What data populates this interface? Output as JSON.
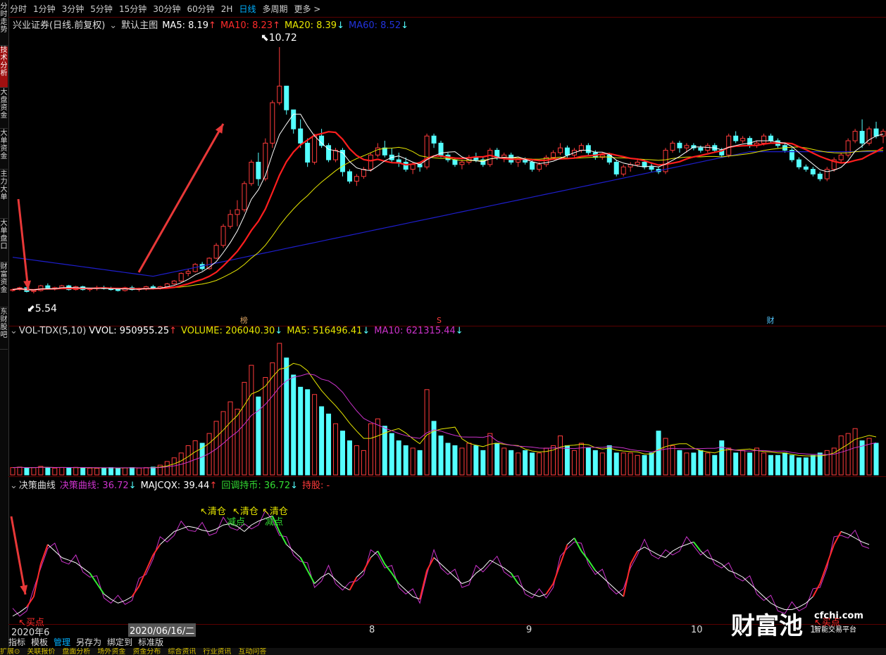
{
  "sidebar": {
    "tabs": [
      "分时走势",
      "技术分析",
      "大盘资金",
      "大单资金",
      "主力大单",
      "大单盘口",
      "财富资金",
      "东财股吧"
    ],
    "active_index": 1
  },
  "period_bar": {
    "items": [
      "分时",
      "1分钟",
      "3分钟",
      "5分钟",
      "15分钟",
      "30分钟",
      "60分钟",
      "2H",
      "日线",
      "多周期",
      "更多"
    ],
    "active": "日线"
  },
  "main_legend": {
    "name": "兴业证券(日线.前复权)",
    "template": "默认主图",
    "ma5": "MA5: 8.19",
    "ma5_arrow": "↑",
    "ma10": "MA10: 8.23",
    "ma10_arrow": "↑",
    "ma20": "MA20: 8.39",
    "ma20_arrow": "↓",
    "ma60": "MA60: 8.52",
    "ma60_arrow": "↓"
  },
  "price_labels": {
    "high": "10.72",
    "low": "5.54"
  },
  "event_markers": [
    "榜",
    "S",
    "财"
  ],
  "volume_legend": {
    "name": "VOL-TDX(5,10)",
    "vvol": "VVOL: 950955.25",
    "vvol_arrow": "↑",
    "volume": "VOLUME: 206040.30",
    "volume_arrow": "↓",
    "ma5": "MA5: 516496.41",
    "ma5_arrow": "↓",
    "ma10": "MA10: 621315.44",
    "ma10_arrow": "↓"
  },
  "decision_legend": {
    "name": "决策曲线",
    "curve": "决策曲线: 36.72",
    "curve_arrow": "↓",
    "majcqx": "MAJCQX: 39.44",
    "majcqx_arrow": "↑",
    "hold": "回调持币: 36.72",
    "hold_arrow": "↓",
    "position": "持股: -"
  },
  "signals": {
    "clear1": "清仓",
    "clear2": "清仓",
    "clear3": "清仓",
    "reduce1": "减点",
    "reduce2": "减点",
    "buy": "买点",
    "buy2": "买点"
  },
  "date_axis": {
    "labels": [
      "2020年6",
      "8",
      "9",
      "10",
      "1"
    ],
    "cursor_date": "2020/06/16/二"
  },
  "bottom_bar": {
    "items": [
      "指标",
      "模板",
      "管理",
      "另存为",
      "绑定到",
      "标准版"
    ],
    "active": "管理"
  },
  "status_bar": {
    "items": [
      "扩展⊙",
      "关联报价",
      "盘面分析",
      "场外资金",
      "资金分布",
      "综合资讯",
      "行业资讯",
      "互动问答"
    ]
  },
  "watermark": {
    "text": "财富池",
    "site": "cfchi.com",
    "sub": "智能交易平台"
  },
  "colors": {
    "up": "#ff3b3b",
    "down": "#54ffff",
    "ma5": "#ffffff",
    "ma10": "#ff1e1e",
    "ma20": "#e6e600",
    "ma60": "#1e1ecc",
    "vol_ma5": "#e6e600",
    "vol_ma10": "#cc33cc",
    "arrow": "#e83838"
  },
  "chart_data": {
    "type": "candlestick",
    "date_range": [
      "2020-06",
      "2020-10"
    ],
    "ylim": [
      5.2,
      11.0
    ],
    "ohlc": [
      [
        5.6,
        5.64,
        5.58,
        5.62
      ],
      [
        5.62,
        5.68,
        5.6,
        5.66
      ],
      [
        5.66,
        5.66,
        5.56,
        5.58
      ],
      [
        5.58,
        5.62,
        5.54,
        5.6
      ],
      [
        5.6,
        5.72,
        5.58,
        5.7
      ],
      [
        5.7,
        5.75,
        5.62,
        5.64
      ],
      [
        5.64,
        5.68,
        5.6,
        5.66
      ],
      [
        5.66,
        5.72,
        5.63,
        5.7
      ],
      [
        5.7,
        5.72,
        5.6,
        5.62
      ],
      [
        5.62,
        5.7,
        5.6,
        5.68
      ],
      [
        5.68,
        5.7,
        5.6,
        5.62
      ],
      [
        5.62,
        5.66,
        5.58,
        5.64
      ],
      [
        5.64,
        5.7,
        5.6,
        5.66
      ],
      [
        5.66,
        5.7,
        5.62,
        5.64
      ],
      [
        5.64,
        5.68,
        5.6,
        5.62
      ],
      [
        5.62,
        5.66,
        5.58,
        5.6
      ],
      [
        5.6,
        5.68,
        5.58,
        5.66
      ],
      [
        5.66,
        5.7,
        5.6,
        5.62
      ],
      [
        5.62,
        5.66,
        5.58,
        5.64
      ],
      [
        5.64,
        5.7,
        5.6,
        5.68
      ],
      [
        5.68,
        5.72,
        5.62,
        5.64
      ],
      [
        5.64,
        5.7,
        5.62,
        5.68
      ],
      [
        5.68,
        5.76,
        5.66,
        5.74
      ],
      [
        5.74,
        5.82,
        5.72,
        5.8
      ],
      [
        5.8,
        5.98,
        5.78,
        5.96
      ],
      [
        5.96,
        6.05,
        5.9,
        6.0
      ],
      [
        6.0,
        6.18,
        5.98,
        6.15
      ],
      [
        6.15,
        6.2,
        6.02,
        6.06
      ],
      [
        6.06,
        6.3,
        6.04,
        6.28
      ],
      [
        6.28,
        6.6,
        6.26,
        6.55
      ],
      [
        6.55,
        7.0,
        6.5,
        6.95
      ],
      [
        6.95,
        7.3,
        6.9,
        7.2
      ],
      [
        7.2,
        7.5,
        6.95,
        7.3
      ],
      [
        7.3,
        7.9,
        7.25,
        7.85
      ],
      [
        7.85,
        8.35,
        7.8,
        8.3
      ],
      [
        8.3,
        8.5,
        7.8,
        7.95
      ],
      [
        7.95,
        8.8,
        7.9,
        8.7
      ],
      [
        8.7,
        9.6,
        8.6,
        9.55
      ],
      [
        9.55,
        10.72,
        9.5,
        9.9
      ],
      [
        9.9,
        9.9,
        9.3,
        9.4
      ],
      [
        9.4,
        9.4,
        8.9,
        9.0
      ],
      [
        9.0,
        9.2,
        8.6,
        8.7
      ],
      [
        8.7,
        8.8,
        8.2,
        8.3
      ],
      [
        8.3,
        8.9,
        8.25,
        8.85
      ],
      [
        8.85,
        9.0,
        8.6,
        8.65
      ],
      [
        8.65,
        8.7,
        8.3,
        8.35
      ],
      [
        8.35,
        8.6,
        8.3,
        8.55
      ],
      [
        8.55,
        8.6,
        8.0,
        8.1
      ],
      [
        8.1,
        8.15,
        7.85,
        7.9
      ],
      [
        7.9,
        8.05,
        7.8,
        8.0
      ],
      [
        8.0,
        8.2,
        7.95,
        8.15
      ],
      [
        8.15,
        8.5,
        8.1,
        8.45
      ],
      [
        8.45,
        8.7,
        8.4,
        8.6
      ],
      [
        8.6,
        8.75,
        8.4,
        8.45
      ],
      [
        8.45,
        8.6,
        8.3,
        8.35
      ],
      [
        8.35,
        8.5,
        8.2,
        8.3
      ],
      [
        8.3,
        8.4,
        8.1,
        8.15
      ],
      [
        8.15,
        8.3,
        8.05,
        8.25
      ],
      [
        8.25,
        8.3,
        8.1,
        8.2
      ],
      [
        8.2,
        8.9,
        8.15,
        8.85
      ],
      [
        8.85,
        8.9,
        8.6,
        8.7
      ],
      [
        8.7,
        8.75,
        8.4,
        8.45
      ],
      [
        8.45,
        8.5,
        8.3,
        8.35
      ],
      [
        8.35,
        8.4,
        8.2,
        8.25
      ],
      [
        8.25,
        8.35,
        8.15,
        8.3
      ],
      [
        8.3,
        8.45,
        8.25,
        8.4
      ],
      [
        8.4,
        8.5,
        8.3,
        8.35
      ],
      [
        8.35,
        8.4,
        8.2,
        8.25
      ],
      [
        8.25,
        8.6,
        8.2,
        8.55
      ],
      [
        8.55,
        8.6,
        8.35,
        8.4
      ],
      [
        8.4,
        8.5,
        8.3,
        8.45
      ],
      [
        8.45,
        8.5,
        8.25,
        8.3
      ],
      [
        8.3,
        8.4,
        8.2,
        8.35
      ],
      [
        8.35,
        8.4,
        8.25,
        8.3
      ],
      [
        8.3,
        8.35,
        8.1,
        8.15
      ],
      [
        8.15,
        8.3,
        8.1,
        8.25
      ],
      [
        8.25,
        8.45,
        8.2,
        8.4
      ],
      [
        8.4,
        8.55,
        8.35,
        8.5
      ],
      [
        8.5,
        8.7,
        8.45,
        8.6
      ],
      [
        8.6,
        8.65,
        8.4,
        8.45
      ],
      [
        8.45,
        8.6,
        8.4,
        8.55
      ],
      [
        8.55,
        8.7,
        8.5,
        8.65
      ],
      [
        8.65,
        8.7,
        8.45,
        8.5
      ],
      [
        8.5,
        8.55,
        8.35,
        8.4
      ],
      [
        8.4,
        8.5,
        8.35,
        8.45
      ],
      [
        8.45,
        8.5,
        8.25,
        8.3
      ],
      [
        8.3,
        8.35,
        8.0,
        8.05
      ],
      [
        8.05,
        8.25,
        8.0,
        8.2
      ],
      [
        8.2,
        8.3,
        8.1,
        8.25
      ],
      [
        8.25,
        8.35,
        8.2,
        8.3
      ],
      [
        8.3,
        8.35,
        8.15,
        8.2
      ],
      [
        8.2,
        8.3,
        8.1,
        8.15
      ],
      [
        8.15,
        8.2,
        8.05,
        8.1
      ],
      [
        8.1,
        8.6,
        8.05,
        8.55
      ],
      [
        8.55,
        8.75,
        8.5,
        8.7
      ],
      [
        8.7,
        8.75,
        8.5,
        8.6
      ],
      [
        8.6,
        8.7,
        8.5,
        8.65
      ],
      [
        8.65,
        8.7,
        8.55,
        8.6
      ],
      [
        8.6,
        8.65,
        8.5,
        8.55
      ],
      [
        8.55,
        8.7,
        8.5,
        8.65
      ],
      [
        8.65,
        8.7,
        8.5,
        8.55
      ],
      [
        8.55,
        8.6,
        8.4,
        8.45
      ],
      [
        8.45,
        8.9,
        8.4,
        8.85
      ],
      [
        8.85,
        8.95,
        8.7,
        8.75
      ],
      [
        8.75,
        8.85,
        8.7,
        8.8
      ],
      [
        8.8,
        8.85,
        8.6,
        8.65
      ],
      [
        8.65,
        8.75,
        8.6,
        8.7
      ],
      [
        8.7,
        8.9,
        8.65,
        8.85
      ],
      [
        8.85,
        8.9,
        8.7,
        8.75
      ],
      [
        8.75,
        8.8,
        8.6,
        8.65
      ],
      [
        8.65,
        8.7,
        8.5,
        8.55
      ],
      [
        8.55,
        8.6,
        8.3,
        8.35
      ],
      [
        8.35,
        8.4,
        8.15,
        8.2
      ],
      [
        8.2,
        8.25,
        8.1,
        8.15
      ],
      [
        8.15,
        8.2,
        8.0,
        8.05
      ],
      [
        8.05,
        8.1,
        7.9,
        7.95
      ],
      [
        7.95,
        8.2,
        7.9,
        8.15
      ],
      [
        8.15,
        8.4,
        8.1,
        8.35
      ],
      [
        8.35,
        8.5,
        8.3,
        8.45
      ],
      [
        8.45,
        8.8,
        8.4,
        8.75
      ],
      [
        8.75,
        9.0,
        8.7,
        8.95
      ],
      [
        8.95,
        9.2,
        8.6,
        8.7
      ],
      [
        8.7,
        9.05,
        8.65,
        9.0
      ],
      [
        9.0,
        9.15,
        8.8,
        8.85
      ],
      [
        8.85,
        9.0,
        8.7,
        8.95
      ]
    ],
    "volume": [
      0.3,
      0.32,
      0.28,
      0.3,
      0.35,
      0.3,
      0.28,
      0.3,
      0.29,
      0.31,
      0.3,
      0.28,
      0.27,
      0.29,
      0.3,
      0.28,
      0.29,
      0.3,
      0.28,
      0.3,
      0.32,
      0.4,
      0.55,
      0.7,
      0.9,
      1.2,
      1.4,
      1.3,
      1.7,
      2.2,
      2.6,
      3.0,
      2.7,
      3.8,
      4.5,
      3.2,
      4.0,
      4.6,
      5.4,
      4.8,
      4.1,
      3.6,
      3.5,
      3.3,
      2.8,
      2.5,
      2.1,
      1.8,
      1.4,
      1.2,
      1.0,
      2.1,
      2.3,
      2.0,
      1.7,
      1.4,
      1.2,
      1.1,
      1.0,
      3.5,
      2.2,
      1.6,
      1.3,
      1.2,
      1.1,
      1.3,
      1.2,
      1.0,
      1.7,
      1.3,
      1.1,
      1.0,
      0.9,
      1.0,
      0.9,
      0.9,
      1.1,
      1.2,
      1.6,
      1.2,
      1.0,
      1.3,
      1.1,
      1.0,
      0.9,
      1.2,
      0.9,
      0.9,
      0.9,
      0.8,
      0.8,
      0.9,
      1.8,
      1.5,
      1.2,
      1.0,
      0.9,
      0.9,
      1.0,
      0.9,
      0.8,
      1.4,
      1.1,
      0.9,
      1.0,
      0.9,
      1.1,
      0.9,
      0.8,
      0.8,
      0.9,
      0.8,
      0.7,
      0.7,
      0.8,
      0.9,
      1.0,
      1.1,
      1.6,
      1.7,
      1.9,
      1.4,
      1.5,
      1.3
    ],
    "decision_curve": [
      5,
      8,
      12,
      20,
      45,
      60,
      55,
      50,
      48,
      46,
      42,
      38,
      30,
      22,
      18,
      15,
      17,
      20,
      28,
      40,
      52,
      60,
      65,
      70,
      72,
      74,
      73,
      71,
      70,
      72,
      75,
      76,
      74,
      70,
      75,
      78,
      80,
      82,
      70,
      60,
      55,
      50,
      40,
      30,
      35,
      38,
      33,
      28,
      25,
      35,
      40,
      50,
      55,
      45,
      38,
      30,
      25,
      20,
      18,
      40,
      50,
      45,
      40,
      35,
      30,
      32,
      38,
      42,
      48,
      45,
      42,
      38,
      30,
      25,
      22,
      20,
      22,
      30,
      45,
      60,
      65,
      55,
      48,
      40,
      35,
      30,
      25,
      20,
      45,
      55,
      58,
      55,
      52,
      50,
      55,
      58,
      60,
      62,
      55,
      50,
      48,
      45,
      40,
      38,
      35,
      30,
      25,
      20,
      15,
      12,
      10,
      10,
      12,
      15,
      20,
      30,
      45,
      60,
      70,
      68,
      65,
      62,
      60
    ],
    "event_markers": [
      {
        "label": "榜",
        "index": 33
      },
      {
        "label": "S",
        "index": 61
      },
      {
        "label": "财",
        "index": 108
      }
    ]
  }
}
